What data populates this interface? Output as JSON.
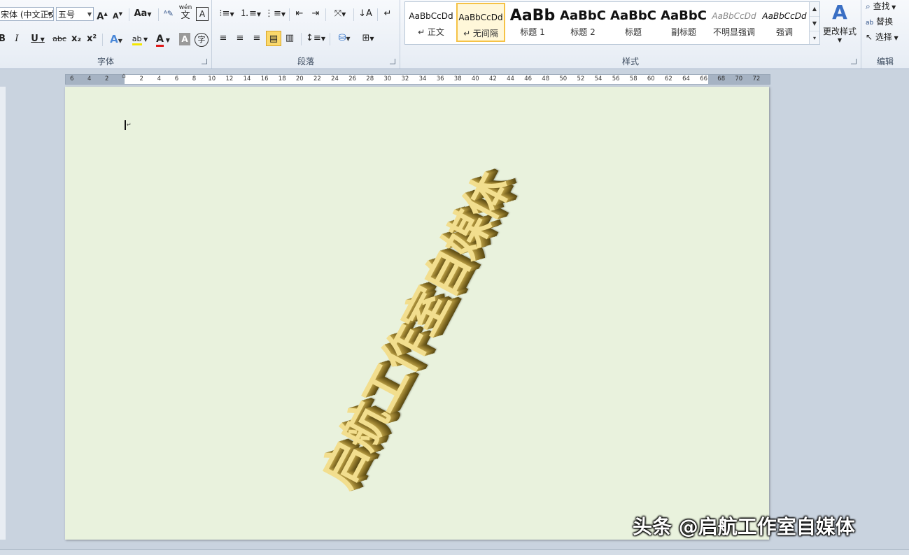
{
  "ribbon": {
    "font_group": {
      "label": "字体",
      "font_name": "宋体 (中文正文",
      "font_size": "五号",
      "grow_font": "A",
      "shrink_font": "A",
      "change_case": "Aa",
      "phonetic": "wén",
      "char_border": "A",
      "bold": "B",
      "italic": "I",
      "underline": "U",
      "strikethrough": "abc",
      "subscript": "x₂",
      "superscript": "x²",
      "text_effects": "A",
      "highlight": "ab",
      "font_color": "A",
      "char_shading": "A",
      "enclose": "字"
    },
    "paragraph_group": {
      "label": "段落"
    },
    "styles_group": {
      "label": "样式",
      "styles": [
        {
          "sample": "AaBbCcDd",
          "name": "↵ 正文"
        },
        {
          "sample": "AaBbCcDd",
          "name": "↵ 无间隔"
        },
        {
          "sample": "AaBb",
          "name": "标题 1"
        },
        {
          "sample": "AaBbC",
          "name": "标题 2"
        },
        {
          "sample": "AaBbC",
          "name": "标题"
        },
        {
          "sample": "AaBbC",
          "name": "副标题"
        },
        {
          "sample": "AaBbCcDd",
          "name": "不明显强调"
        },
        {
          "sample": "AaBbCcDd",
          "name": "强调"
        }
      ],
      "change_styles": "更改样式"
    },
    "editing_group": {
      "label": "编辑",
      "find": "查找",
      "replace": "替换",
      "select": "选择"
    }
  },
  "ruler": {
    "left_labels": [
      "6",
      "4",
      "2"
    ],
    "labels": [
      "2",
      "4",
      "6",
      "8",
      "10",
      "12",
      "14",
      "16",
      "18",
      "20",
      "22",
      "24",
      "26",
      "28",
      "30",
      "32",
      "34",
      "36",
      "38",
      "40",
      "42",
      "44",
      "46",
      "48",
      "50",
      "52",
      "54",
      "56",
      "58",
      "60",
      "62",
      "64",
      "66",
      "68",
      "70",
      "72"
    ]
  },
  "document": {
    "wordart_text": "启航工作室自媒体"
  },
  "watermark": "头条 @启航工作室自媒体",
  "colors": {
    "page_background": "#e9f2dd",
    "wordart_face": "#f2de8e",
    "selected_style": "#f5c246"
  }
}
